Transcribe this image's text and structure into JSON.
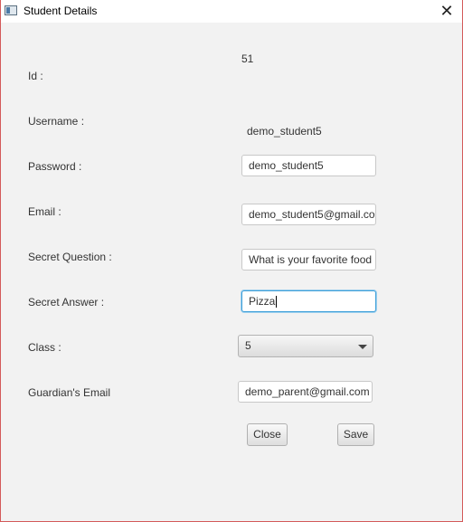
{
  "window": {
    "title": "Student Details"
  },
  "form": {
    "id_label": "Id :",
    "id_value": "51",
    "username_label": "Username :",
    "username_value": "demo_student5",
    "password_label": "Password :",
    "password_value": "demo_student5",
    "email_label": "Email :",
    "email_value": "demo_student5@gmail.co",
    "secret_question_label": "Secret Question :",
    "secret_question_value": "What is your favorite food",
    "secret_answer_label": "Secret Answer :",
    "secret_answer_value": "Pizza",
    "class_label": "Class :",
    "class_value": "5",
    "guardian_email_label": "Guardian's Email",
    "guardian_email_value": "demo_parent@gmail.com"
  },
  "buttons": {
    "close_label": "Close",
    "save_label": "Save"
  },
  "icons": {
    "app": "app-window-icon",
    "close": "close-icon"
  }
}
